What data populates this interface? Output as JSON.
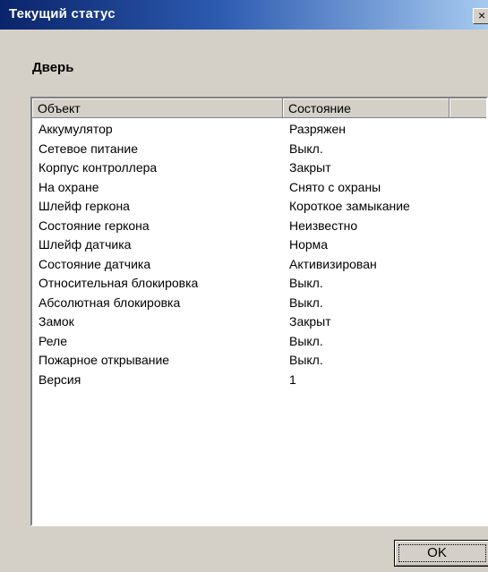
{
  "window": {
    "title": "Текущий статус",
    "close_glyph": "×"
  },
  "group": {
    "label": "Дверь"
  },
  "listview": {
    "columns": [
      "Объект",
      "Состояние",
      ""
    ],
    "rows": [
      [
        "Аккумулятор",
        "Разряжен"
      ],
      [
        "Сетевое питание",
        "Выкл."
      ],
      [
        "Корпус контроллера",
        "Закрыт"
      ],
      [
        "На охране",
        "Снято с охраны"
      ],
      [
        "Шлейф геркона",
        "Короткое замыкание"
      ],
      [
        "Состояние геркона",
        "Неизвестно"
      ],
      [
        "Шлейф датчика",
        "Норма"
      ],
      [
        "Состояние датчика",
        "Активизирован"
      ],
      [
        "Относительная блокировка",
        "Выкл."
      ],
      [
        "Абсолютная блокировка",
        "Выкл."
      ],
      [
        "Замок",
        "Закрыт"
      ],
      [
        "Реле",
        "Выкл."
      ],
      [
        "Пожарное открывание",
        "Выкл."
      ],
      [
        "Версия",
        "1"
      ]
    ]
  },
  "buttons": {
    "ok_label": "OK"
  },
  "colors": {
    "titlebar_start": "#0a246a",
    "titlebar_end": "#a6caf0",
    "face": "#d4d0c8"
  }
}
